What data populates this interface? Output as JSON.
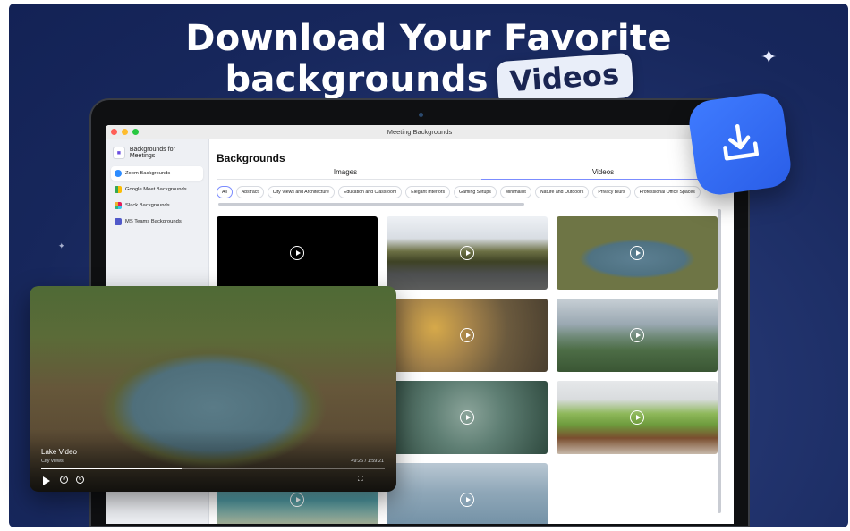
{
  "headline": {
    "line1": "Download Your Favorite",
    "line2": "backgrounds",
    "pill": "Videos"
  },
  "window": {
    "title": "Meeting Backgrounds"
  },
  "sidebar": {
    "app_title": "Backgrounds for Meetings",
    "items": [
      {
        "label": "Zoom Backgrounds",
        "icon": "zoom-icon",
        "active": true
      },
      {
        "label": "Google Meet Backgrounds",
        "icon": "google-meet-icon",
        "active": false
      },
      {
        "label": "Slack Backgrounds",
        "icon": "slack-icon",
        "active": false
      },
      {
        "label": "MS Teams Backgrounds",
        "icon": "teams-icon",
        "active": false
      }
    ]
  },
  "main": {
    "title": "Backgrounds",
    "tabs": [
      {
        "label": "Images",
        "active": false
      },
      {
        "label": "Videos",
        "active": true
      }
    ],
    "chips": [
      "All",
      "Abstract",
      "City Views and Architecture",
      "Education and Classroom",
      "Elegant Interiors",
      "Gaming Setups",
      "Minimalist",
      "Nature and Outdoors",
      "Privacy Blurs",
      "Professional Office Spaces"
    ],
    "active_chip": "All"
  },
  "player": {
    "title": "Lake Video",
    "subtitle": "City views",
    "time": "49:26 / 1:59:21",
    "progress": 0.41,
    "controls": [
      "play-icon",
      "skip-back-icon",
      "skip-forward-icon",
      "fullscreen-icon",
      "more-icon"
    ]
  },
  "colors": {
    "accent": "#7b8cff",
    "badge": "#2f66f0",
    "background": "#17275c"
  }
}
